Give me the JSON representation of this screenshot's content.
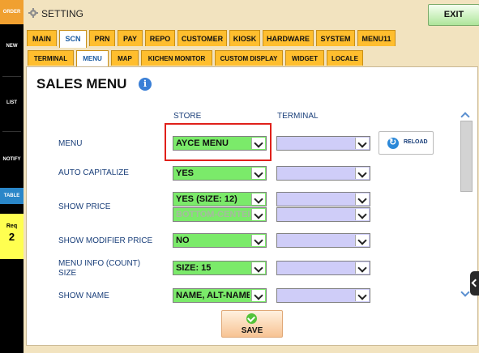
{
  "rail": {
    "order": "ORDER",
    "new": "NEW",
    "list": "LIST",
    "notify": "NOTIFY",
    "table": "TABLE",
    "req_label": "Req",
    "req_count": "2"
  },
  "header": {
    "title": "SETTING",
    "exit_label": "EXIT"
  },
  "tabs": [
    "MAIN",
    "SCN",
    "PRN",
    "PAY",
    "REPO",
    "CUSTOMER",
    "KIOSK",
    "HARDWARE",
    "SYSTEM",
    "MENU11"
  ],
  "active_tab": "SCN",
  "subtabs": [
    "TERMINAL",
    "MENU",
    "MAP",
    "KICHEN MONITOR",
    "CUSTOM DISPLAY",
    "WIDGET",
    "LOCALE"
  ],
  "active_subtab": "MENU",
  "page": {
    "heading": "SALES MENU",
    "info_icon": "i",
    "col_store": "STORE",
    "col_terminal": "TERMINAL"
  },
  "rows": {
    "menu": {
      "label": "MENU",
      "store_value": "AYCE MENU",
      "terminal_value": ""
    },
    "auto_capitalize": {
      "label": "AUTO CAPITALIZE",
      "store_value": "YES",
      "terminal_value": ""
    },
    "show_price": {
      "label": "SHOW PRICE",
      "store_value": "YES (SIZE: 12)",
      "store_value_2": "BOTTOM-CENTER",
      "terminal_value": "",
      "terminal_value_2": ""
    },
    "show_modifier_price": {
      "label": "SHOW MODIFIER PRICE",
      "store_value": "NO",
      "terminal_value": ""
    },
    "menu_info": {
      "label": "MENU INFO (COUNT) SIZE",
      "store_value": "SIZE: 15",
      "terminal_value": ""
    },
    "show_name": {
      "label": "SHOW NAME",
      "store_value": "NAME, ALT-NAME",
      "terminal_value": ""
    }
  },
  "reload_label": "RELOAD",
  "save_label": "SAVE",
  "colors": {
    "tab": "#ffbe2e",
    "store_select": "#7bea6a",
    "terminal_select": "#cfcdf8",
    "highlight": "#e0201a",
    "label_text": "#1a3f7a"
  }
}
